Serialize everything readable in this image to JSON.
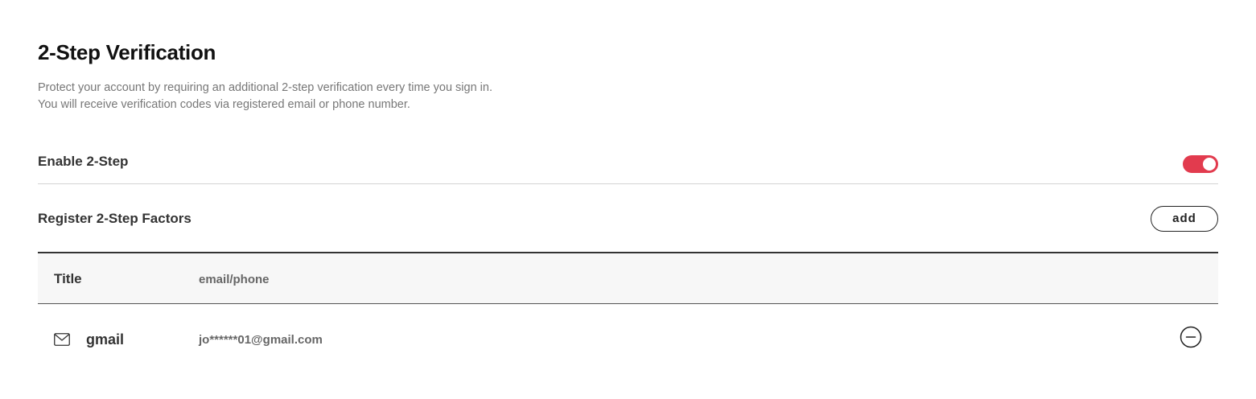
{
  "page": {
    "title": "2-Step Verification",
    "description_line1": "Protect your account by requiring an additional 2-step verification every time you sign in.",
    "description_line2": "You will receive verification codes via registered email or phone number."
  },
  "enable_two_step": {
    "label": "Enable 2-Step",
    "enabled": true,
    "toggle_color": "#e23b4e"
  },
  "register_factors": {
    "label": "Register 2-Step Factors",
    "add_label": "add"
  },
  "factor_table": {
    "columns": [
      "Title",
      "email/phone"
    ],
    "rows": [
      {
        "icon": "mail-icon",
        "title": "gmail",
        "contact": "jo******01@gmail.com",
        "action_icon": "remove-circle-icon"
      }
    ]
  }
}
